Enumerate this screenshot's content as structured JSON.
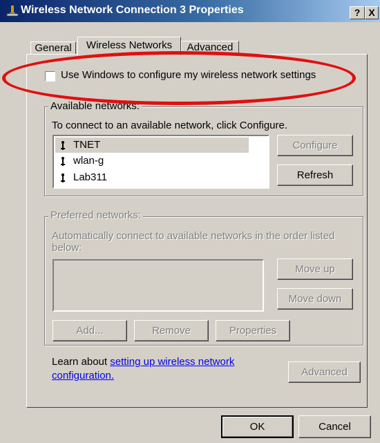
{
  "window": {
    "title": "Wireless Network Connection 3 Properties",
    "help_button": "?",
    "close_button": "X",
    "icon": "network-connection-icon"
  },
  "tabs": [
    {
      "label": "General",
      "active": false
    },
    {
      "label": "Wireless Networks",
      "active": true
    },
    {
      "label": "Advanced",
      "active": false
    }
  ],
  "use_windows_checkbox": {
    "label": "Use Windows to configure my wireless network settings",
    "checked": false
  },
  "available_networks": {
    "legend": "Available networks:",
    "description": "To connect to an available network, click Configure.",
    "networks": [
      {
        "name": "TNET",
        "icon": "antenna-icon",
        "selected": true
      },
      {
        "name": "wlan-g",
        "icon": "antenna-icon",
        "selected": false
      },
      {
        "name": "Lab311",
        "icon": "antenna-icon",
        "selected": false
      }
    ],
    "configure_label": "Configure",
    "refresh_label": "Refresh"
  },
  "preferred_networks": {
    "legend": "Preferred networks:",
    "description_line1": "Automatically connect to available networks in the order listed",
    "description_line2": "below:",
    "move_up_label": "Move up",
    "move_down_label": "Move down",
    "add_label": "Add...",
    "remove_label": "Remove",
    "properties_label": "Properties"
  },
  "learn_about": {
    "prefix": "Learn about ",
    "link_line1": "setting up wireless network",
    "link_line2": "configuration.",
    "advanced_label": "Advanced"
  },
  "footer": {
    "ok_label": "OK",
    "cancel_label": "Cancel"
  },
  "colors": {
    "annotation_ellipse": "#e01010",
    "titlebar_start": "#0a246a",
    "face": "#d4d0c8",
    "link": "#0000ee"
  }
}
